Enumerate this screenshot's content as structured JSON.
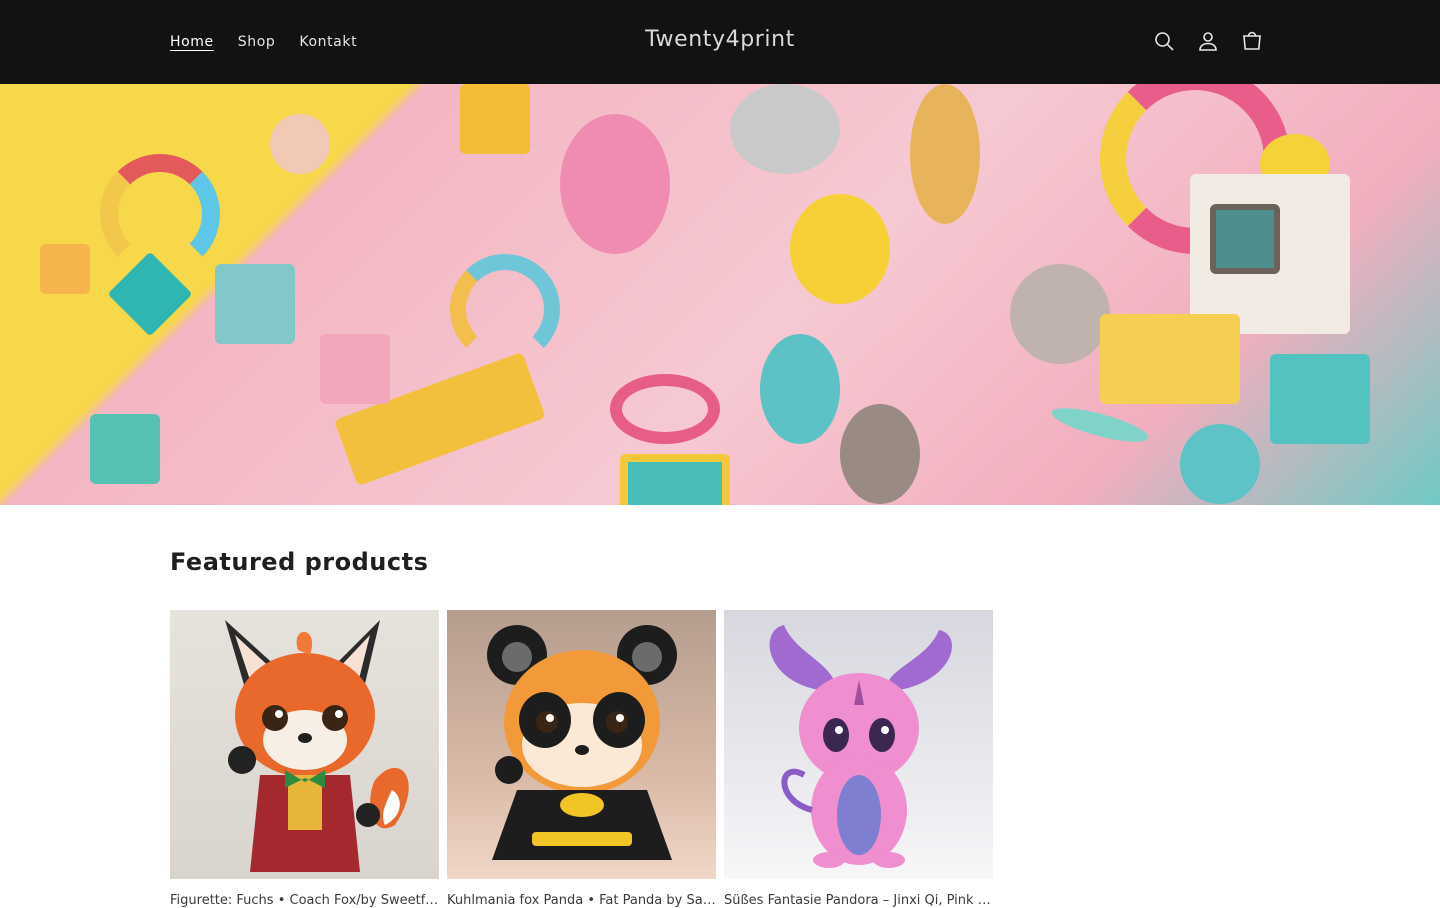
{
  "header": {
    "brand": "Twenty4print",
    "nav": [
      {
        "label": "Home"
      },
      {
        "label": "Shop"
      },
      {
        "label": "Kontakt"
      }
    ],
    "icons": [
      "search-icon",
      "account-icon",
      "cart-icon"
    ]
  },
  "featured": {
    "title": "Featured products",
    "products": [
      {
        "title": "Figurette: Fuchs • Coach Fox/by Sweetfy/cell"
      },
      {
        "title": "Kuhlmania fox Panda • Fat Panda by Sandrichnut"
      },
      {
        "title": "Süßes Fantasie Pandora – Jinxi Qi, Pink Ge"
      }
    ]
  }
}
